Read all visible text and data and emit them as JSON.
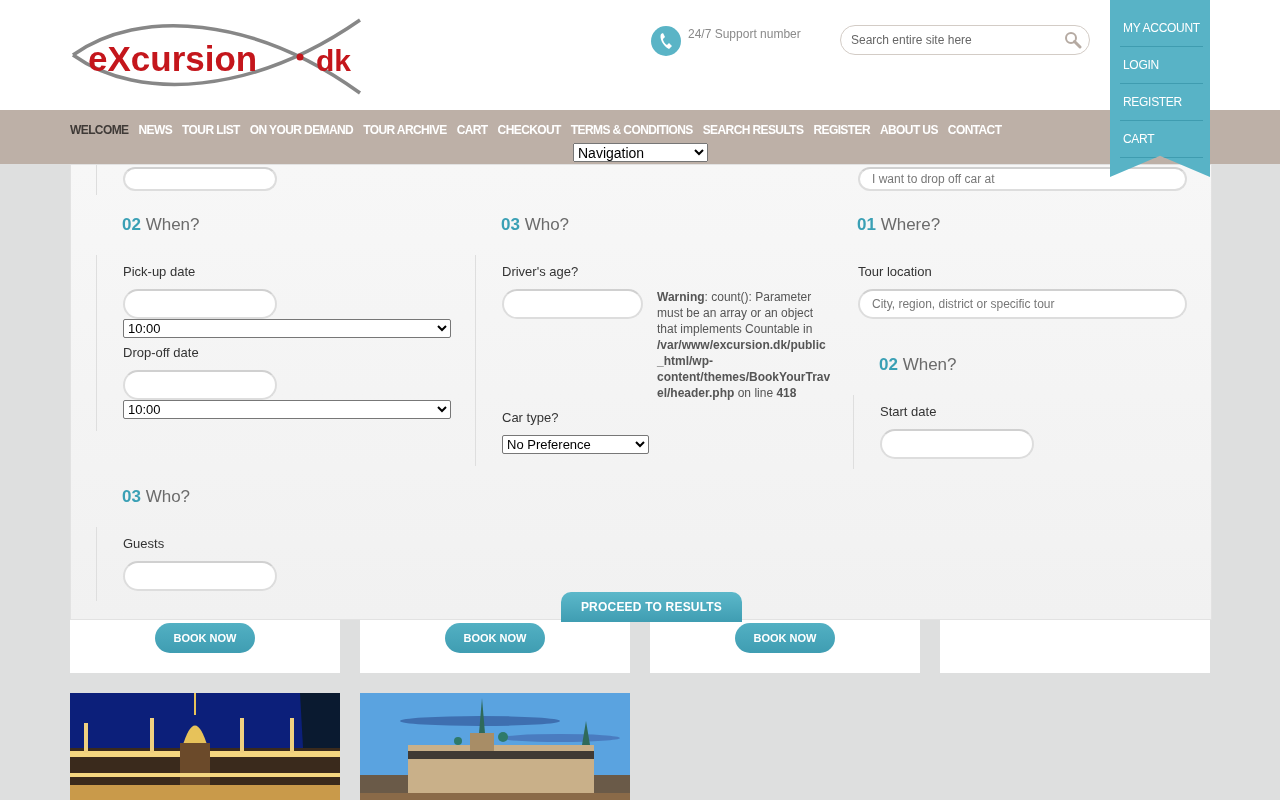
{
  "logo": {
    "word": "eXcursion",
    "domain": "dk"
  },
  "support": {
    "label": "24/7 Support number"
  },
  "search": {
    "placeholder": "Search entire site here"
  },
  "account_menu": [
    "MY ACCOUNT",
    "LOGIN",
    "REGISTER",
    "CART"
  ],
  "nav": {
    "items": [
      {
        "label": "WELCOME",
        "selected": true
      },
      {
        "label": "NEWS",
        "selected": false
      },
      {
        "label": "TOUR LIST",
        "selected": false
      },
      {
        "label": "ON YOUR DEMAND",
        "selected": false
      },
      {
        "label": "TOUR ARCHIVE",
        "selected": false
      },
      {
        "label": "CART",
        "selected": false
      },
      {
        "label": "CHECKOUT",
        "selected": false
      },
      {
        "label": "TERMS & CONDITIONS",
        "selected": false
      },
      {
        "label": "SEARCH RESULTS",
        "selected": false
      },
      {
        "label": "REGISTER",
        "selected": false
      },
      {
        "label": "ABOUT US",
        "selected": false
      },
      {
        "label": "CONTACT",
        "selected": false
      }
    ],
    "select": "Navigation"
  },
  "panel": {
    "stub": [
      {
        "kind": "input"
      },
      {
        "kind": "spacer"
      },
      {
        "kind": "input",
        "wide": true,
        "placeholder": "I want to drop off car at"
      }
    ],
    "columns": [
      [
        {
          "kind": "ruled",
          "number": "02",
          "title": "When?",
          "fields": [
            {
              "kind": "input",
              "label": "Pick-up date"
            },
            {
              "kind": "select",
              "wide": true,
              "value": "10:00"
            },
            {
              "kind": "input",
              "label": "Drop-off date"
            },
            {
              "kind": "select",
              "wide": true,
              "value": "10:00"
            }
          ]
        },
        {
          "kind": "ruled",
          "number": "03",
          "title": "Who?",
          "fields": [
            {
              "kind": "input",
              "label": "Guests"
            }
          ]
        }
      ],
      [
        {
          "kind": "ruled",
          "number": "03",
          "title": "Who?",
          "fields": [
            {
              "kind": "input",
              "label": "Driver's age?",
              "notice": "**Warning**: count(): Parameter must be an array or an object that implements Countable in **/var/www/excursion.dk/public_html/wp-content/themes/BookYourTravel/header.php** on line **418**"
            },
            {
              "kind": "select",
              "label": "Car type?",
              "value": "No Preference"
            }
          ]
        }
      ],
      [
        {
          "kind": "plain",
          "number": "01",
          "title": "Where?",
          "fields": [
            {
              "kind": "input",
              "wide": true,
              "label": "Tour location",
              "placeholder": "City, region, district or specific tour"
            }
          ],
          "children": [
            {
              "kind": "ruled",
              "number": "02",
              "title": "When?",
              "fields": [
                {
                  "kind": "input",
                  "label": "Start date"
                }
              ]
            }
          ]
        }
      ]
    ],
    "proceed_button": "PROCEED TO RESULTS"
  },
  "cards": [
    {
      "kind": "offer",
      "button": "BOOK NOW"
    },
    {
      "kind": "offer",
      "button": "BOOK NOW"
    },
    {
      "kind": "offer",
      "button": "BOOK NOW"
    },
    {
      "kind": "blank"
    }
  ]
}
